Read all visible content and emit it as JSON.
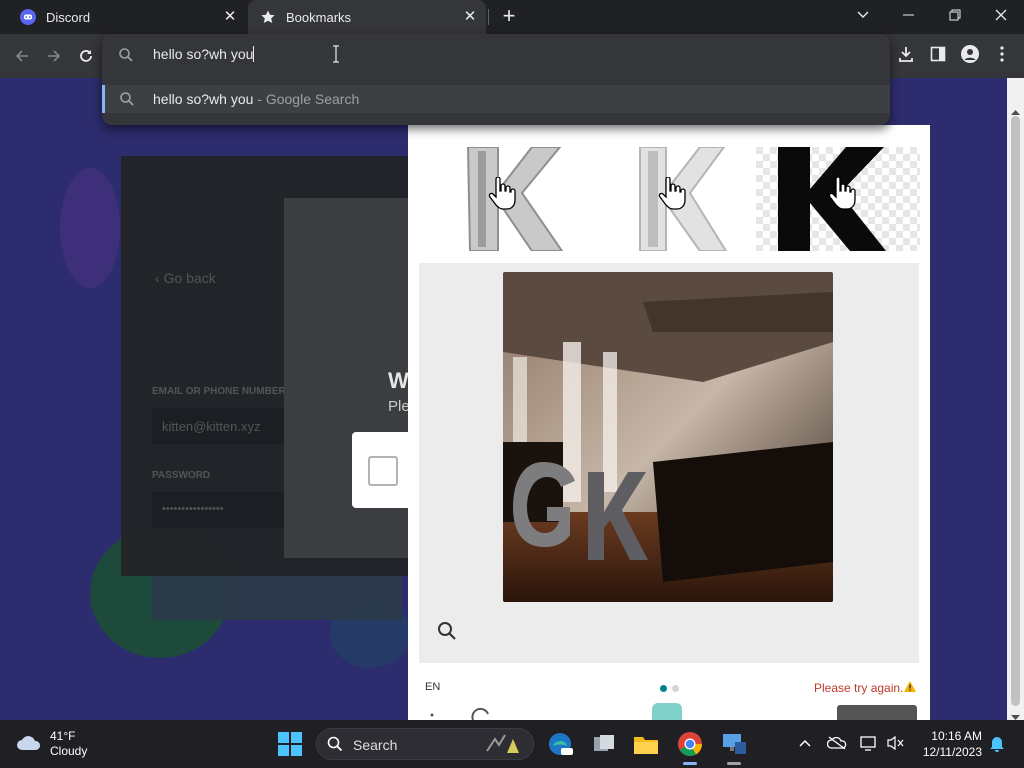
{
  "browser": {
    "tabs": [
      {
        "label": "Discord",
        "active": false,
        "icon": "discord-icon"
      },
      {
        "label": "Bookmarks",
        "active": true,
        "icon": "star-icon"
      }
    ],
    "omnibox": {
      "value": "hello so?wh you",
      "suggestion": {
        "query": "hello so?wh you",
        "sub": " - Google Search"
      }
    }
  },
  "page": {
    "login": {
      "go_back": "Go back",
      "email_label": "EMAIL OR PHONE NUMBER",
      "email_value": "kitten@kitten.xyz",
      "password_label": "PASSWORD",
      "password_value": "••••••••••••••••"
    },
    "dialog": {
      "title": "W",
      "subtitle": "Ple"
    },
    "captcha": {
      "language": "EN",
      "error": "Please try again.",
      "accent_color": "#00838f"
    }
  },
  "taskbar": {
    "weather": {
      "temp": "41°F",
      "condition": "Cloudy"
    },
    "search_label": "Search",
    "clock": {
      "time": "10:16 AM",
      "date": "12/11/2023"
    }
  }
}
